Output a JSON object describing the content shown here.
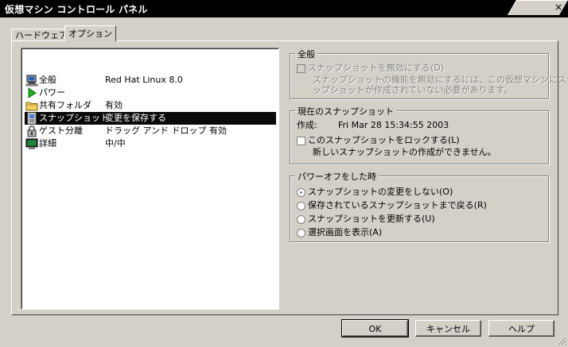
{
  "window": {
    "title": "仮想マシン コントロール パネル",
    "close": "×"
  },
  "tabs": [
    {
      "label": "ハードウェア",
      "active": false
    },
    {
      "label": "オプション",
      "active": true
    }
  ],
  "list": {
    "items": [
      {
        "label": "全般",
        "value": "Red Hat Linux 8.0",
        "icon": "computer-icon"
      },
      {
        "label": "パワー",
        "value": "",
        "icon": "power-play-icon"
      },
      {
        "label": "共有フォルダ",
        "value": "有効",
        "icon": "folder-icon"
      },
      {
        "label": "スナップショット",
        "value": "変更を保存する",
        "icon": "snapshot-icon",
        "selected": true
      },
      {
        "label": "ゲスト分離",
        "value": "ドラッグ アンド ドロップ 有効",
        "icon": "lock-icon"
      },
      {
        "label": "詳細",
        "value": "中/中",
        "icon": "monitor-icon"
      }
    ]
  },
  "general": {
    "title": "全般",
    "disable_checkbox": "スナップショットを無効にする(D)",
    "disable_desc_1": "スナップショットの機能を無効にするには、この仮想マシンにスナ",
    "disable_desc_2": "ップショットが作成されていない必要があります。"
  },
  "current": {
    "title": "現在のスナップショット",
    "created_label": "作成:",
    "created_value": "Fri Mar 28 15:34:55 2003",
    "lock_checkbox": "このスナップショットをロックする(L)",
    "lock_desc": "新しいスナップショットの作成ができません。"
  },
  "poweroff": {
    "title": "パワーオフをした時",
    "options": [
      {
        "label": "スナップショットの変更をしない(O)",
        "checked": true
      },
      {
        "label": "保存されているスナップショットまで戻る(R)",
        "checked": false
      },
      {
        "label": "スナップショットを更新する(U)",
        "checked": false
      },
      {
        "label": "選択画面を表示(A)",
        "checked": false
      }
    ]
  },
  "buttons": {
    "ok": "OK",
    "cancel": "キャンセル",
    "help": "ヘルプ"
  }
}
